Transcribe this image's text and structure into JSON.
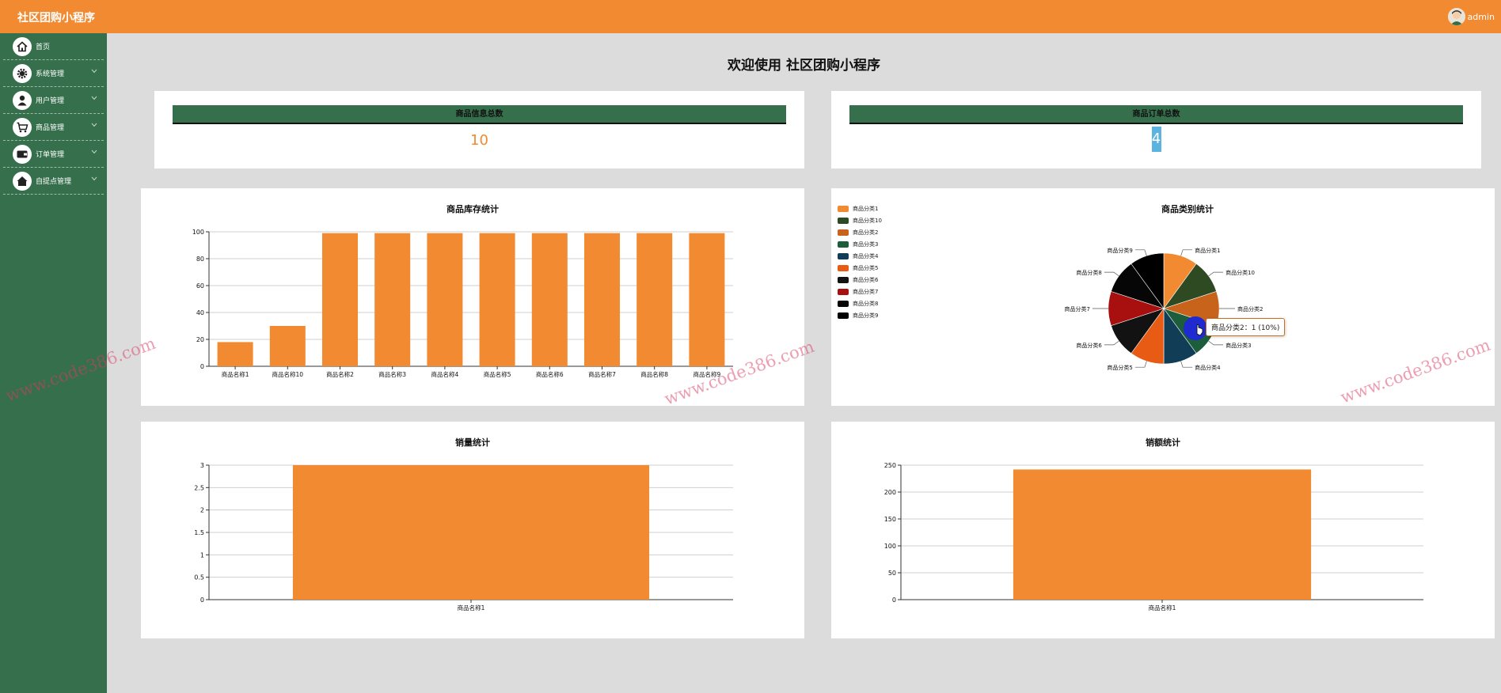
{
  "app": {
    "title": "社区团购小程序",
    "user": "admin"
  },
  "sidebar": {
    "items": [
      {
        "label": "首页",
        "icon": "home-icon",
        "has_children": false
      },
      {
        "label": "系统管理",
        "icon": "gear-icon",
        "has_children": true
      },
      {
        "label": "用户管理",
        "icon": "user-icon",
        "has_children": true
      },
      {
        "label": "商品管理",
        "icon": "cart-icon",
        "has_children": true
      },
      {
        "label": "订单管理",
        "icon": "wallet-icon",
        "has_children": true
      },
      {
        "label": "自提点管理",
        "icon": "house-icon",
        "has_children": true
      }
    ]
  },
  "welcome": "欢迎使用 社区团购小程序",
  "stats": [
    {
      "label": "商品信息总数",
      "value": "10"
    },
    {
      "label": "商品订单总数",
      "value": "4"
    }
  ],
  "colors": {
    "topbar": "#f28a31",
    "sidebar": "#356f4b",
    "bar": "#f28a31",
    "pie": [
      "#f28a31",
      "#2d4a22",
      "#c7631a",
      "#1c5e3c",
      "#123d57",
      "#e85b14",
      "#121212",
      "#a81010",
      "#060606",
      "#000000"
    ]
  },
  "tooltip": "商品分类2：1 (10%)",
  "watermark": "www.code386.com",
  "chart_data": [
    {
      "type": "bar",
      "title": "商品库存统计",
      "categories": [
        "商品名称1",
        "商品名称10",
        "商品名称2",
        "商品名称3",
        "商品名称4",
        "商品名称5",
        "商品名称6",
        "商品名称7",
        "商品名称8",
        "商品名称9"
      ],
      "values": [
        18,
        30,
        99,
        99,
        99,
        99,
        99,
        99,
        99,
        99
      ],
      "ylim": [
        0,
        100
      ],
      "yticks": [
        0,
        20,
        40,
        60,
        80,
        100
      ],
      "grid": true
    },
    {
      "type": "pie",
      "title": "商品类别统计",
      "categories": [
        "商品分类1",
        "商品分类10",
        "商品分类2",
        "商品分类3",
        "商品分类4",
        "商品分类5",
        "商品分类6",
        "商品分类7",
        "商品分类8",
        "商品分类9"
      ],
      "values": [
        1,
        1,
        1,
        1,
        1,
        1,
        1,
        1,
        1,
        1
      ],
      "legend": "top-left"
    },
    {
      "type": "bar",
      "title": "销量统计",
      "categories": [
        "商品名称1"
      ],
      "values": [
        3
      ],
      "ylim": [
        0,
        3
      ],
      "yticks": [
        0,
        0.5,
        1,
        1.5,
        2,
        2.5,
        3
      ],
      "grid": true
    },
    {
      "type": "bar",
      "title": "销额统计",
      "categories": [
        "商品名称1"
      ],
      "values": [
        242
      ],
      "ylim": [
        0,
        250
      ],
      "yticks": [
        0,
        50,
        100,
        150,
        200,
        250
      ],
      "grid": true
    }
  ]
}
